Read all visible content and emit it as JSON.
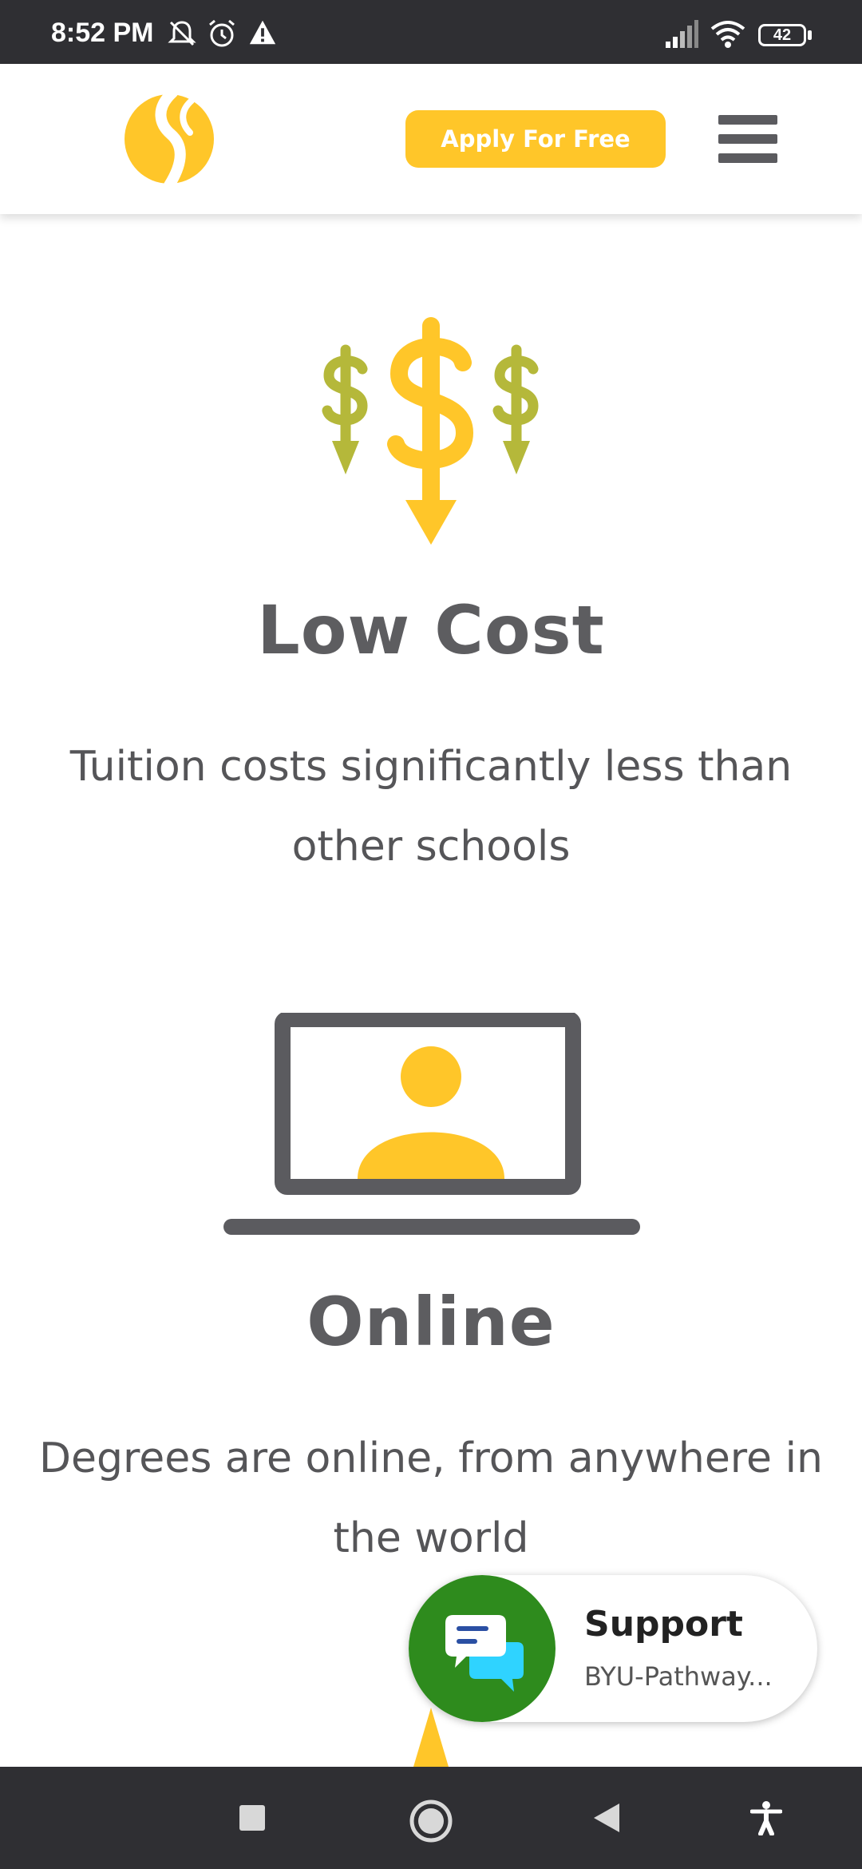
{
  "status_bar": {
    "time": "8:52 PM",
    "battery": "42",
    "icons": [
      "mute-icon",
      "alarm-icon",
      "warning-icon",
      "signal-icon",
      "wifi-icon",
      "battery-icon"
    ]
  },
  "header": {
    "logo": "byu-pathway-logo",
    "apply_label": "Apply For Free",
    "menu_icon": "hamburger-menu-icon"
  },
  "features": [
    {
      "icon": "dollar-signs-down-icon",
      "title": "Low Cost",
      "description": "Tuition costs significantly less than other schools"
    },
    {
      "icon": "laptop-person-icon",
      "title": "Online",
      "description": "Degrees are online, from anywhere in the world"
    }
  ],
  "support_widget": {
    "title": "Support",
    "subtitle": "BYU-Pathway..."
  },
  "nav_bar": {
    "buttons": [
      "recent-apps-icon",
      "home-icon",
      "back-icon",
      "accessibility-icon"
    ]
  },
  "colors": {
    "accent": "#ffc629",
    "olive": "#b5b83a",
    "text_gray": "#5d5d60",
    "support_green": "#2e8b1d",
    "system_bar": "#2f2f33"
  }
}
